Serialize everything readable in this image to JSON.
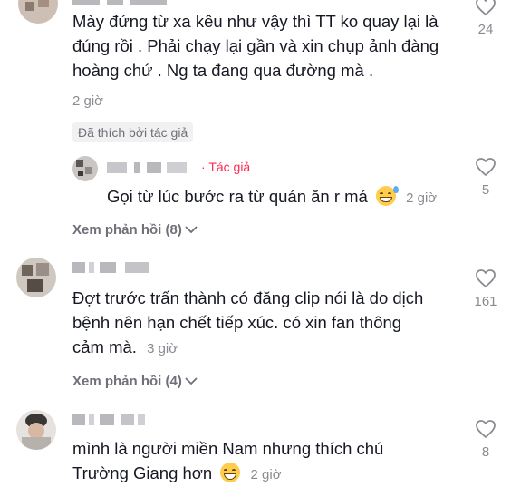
{
  "comments": [
    {
      "text": "Mày đứng từ xa kêu như vậy thì TT ko quay lại là đúng rồi . Phải chạy lại gần và xin chụp ảnh đàng hoàng chứ . Ng ta đang qua đường mà .",
      "time": "2 giờ",
      "likes": "24",
      "liked_by_author": "Đã thích bởi tác giả"
    },
    {
      "author_tag": "Tác giả",
      "text": "Gọi từ lúc bước ra từ quán ăn r má",
      "emoji": "sweat-smile-emoji",
      "time": "2 giờ",
      "likes": "5"
    },
    {
      "view_replies": "Xem phản hồi (8)"
    },
    {
      "text": "Đợt trước trấn thành có đăng clip nói là do dịch bệnh nên hạn chết tiếp xúc. có xin fan thông cảm mà.",
      "time": "3 giờ",
      "likes": "161",
      "view_replies": "Xem phản hồi (4)"
    },
    {
      "text": "mình là người miền Nam nhưng thích chú Trường Giang hơn",
      "emoji": "grinning-emoji",
      "time": "2 giờ",
      "likes": "8"
    }
  ],
  "icons": {
    "like": "heart-outline-icon",
    "chevron": "chevron-down-icon"
  },
  "colors": {
    "author_tag": "#fe2c55",
    "secondary": "#8a8b91",
    "text": "#161823"
  }
}
